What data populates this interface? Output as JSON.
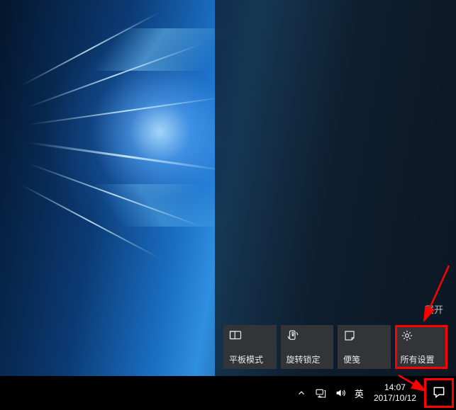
{
  "action_center": {
    "expand_label": "展开",
    "tiles": [
      {
        "id": "tablet-mode",
        "label": "平板模式",
        "icon": "tablet-icon"
      },
      {
        "id": "rotation-lock",
        "label": "旋转锁定",
        "icon": "rotation-lock-icon"
      },
      {
        "id": "sticky-notes",
        "label": "便笺",
        "icon": "sticky-notes-icon"
      },
      {
        "id": "all-settings",
        "label": "所有设置",
        "icon": "settings-gear-icon"
      }
    ]
  },
  "system_tray": {
    "ime_indicator": "英",
    "time": "14:07",
    "date": "2017/10/12"
  },
  "annotation": {
    "color": "#ff0000"
  }
}
